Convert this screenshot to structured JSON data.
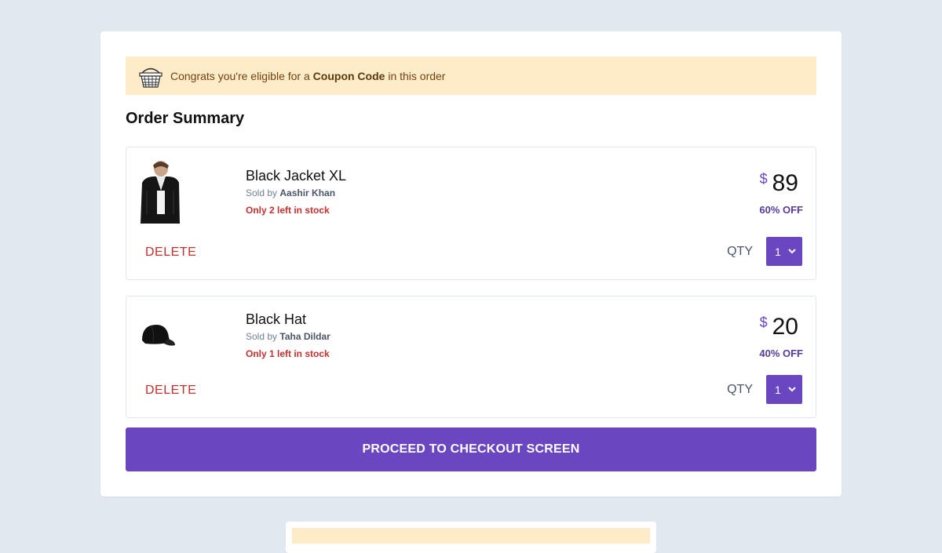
{
  "banner": {
    "prefix": "Congrats you're eligible for a",
    "highlight": "Coupon Code",
    "suffix": "in this order",
    "icon": "basket-icon"
  },
  "summary": {
    "title": "Order Summary"
  },
  "items": [
    {
      "name": "Black Jacket XL",
      "sold_by_label": "Sold by",
      "seller": "Aashir Khan",
      "stock": "Only 2 left in stock",
      "currency": "$",
      "price": "89",
      "discount": "60% OFF",
      "delete_label": "DELETE",
      "qty_label": "QTY",
      "qty_value": "1",
      "image": "jacket-image"
    },
    {
      "name": "Black Hat",
      "sold_by_label": "Sold by",
      "seller": "Taha Dildar",
      "stock": "Only 1 left in stock",
      "currency": "$",
      "price": "20",
      "discount": "40% OFF",
      "delete_label": "DELETE",
      "qty_label": "QTY",
      "qty_value": "1",
      "image": "hat-image"
    }
  ],
  "checkout": {
    "label": "PROCEED TO CHECKOUT SCREEN"
  },
  "colors": {
    "accent": "#6b46c1",
    "banner_bg": "#feebc8",
    "danger": "#c53030",
    "page_bg": "#e2e8f0"
  }
}
